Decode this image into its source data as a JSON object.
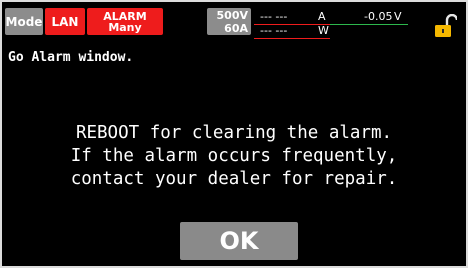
{
  "status_bar": {
    "mode_label": "Mode",
    "lan_label": "LAN",
    "alarm_line1": "ALARM",
    "alarm_line2": "Many",
    "voltage_rating": "500V",
    "current_rating": "60A",
    "current_value": "--- ---",
    "current_unit": "A",
    "voltage_value": "-0.05",
    "voltage_unit": "V",
    "power_value": "--- ---",
    "power_unit": "W"
  },
  "message": {
    "title": "Go Alarm window.",
    "lines": [
      "REBOOT for clearing the alarm.",
      "If the alarm occurs frequently,",
      "contact your dealer for repair."
    ]
  },
  "ok_button": {
    "label": "OK"
  },
  "colors": {
    "alarm": "#ee1c1c",
    "badge_gray": "#8c8c8c",
    "lock": "#f5b800",
    "current_line": "#ee1c1c",
    "voltage_line": "#2db84d"
  }
}
